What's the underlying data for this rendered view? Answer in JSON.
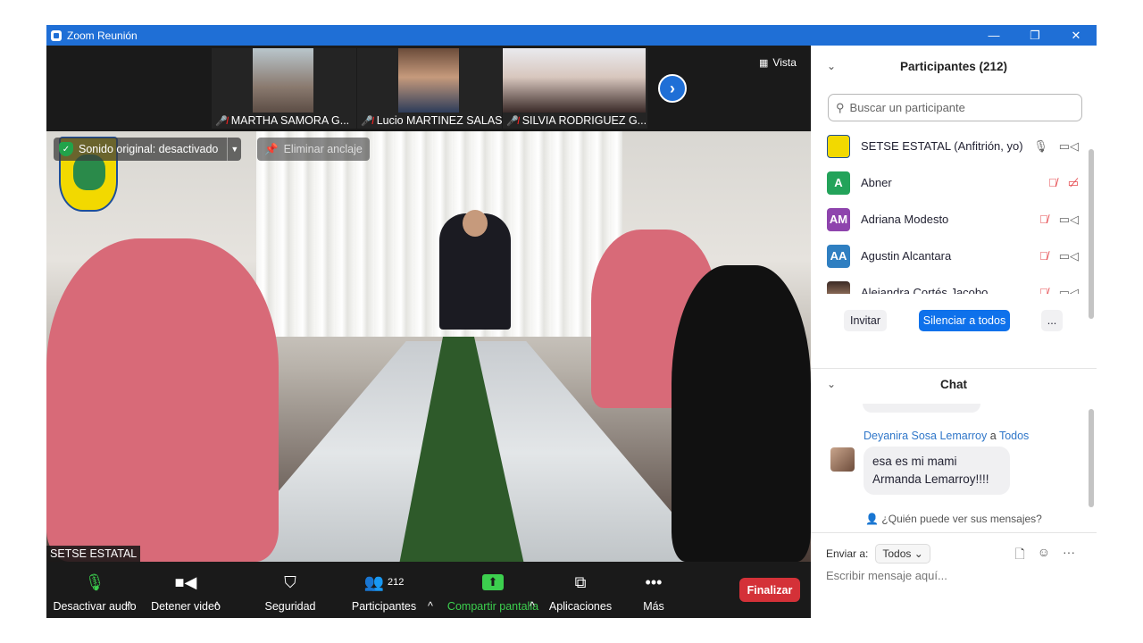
{
  "window": {
    "title": "Zoom Reunión",
    "minimize": "—",
    "restore": "❐",
    "close": "✕"
  },
  "strip": {
    "thumbs": [
      {
        "name": "MARTHA SAMORA G..."
      },
      {
        "name": "Lucio MARTINEZ SALAS"
      },
      {
        "name": "SILVIA RODRIGUEZ G..."
      }
    ],
    "next_icon": "chevron-right-icon",
    "view_label": "Vista"
  },
  "main_video": {
    "original_sound": "Sonido original: desactivado",
    "unpin": "Eliminar anclaje",
    "name": "SETSE ESTATAL"
  },
  "toolbar": {
    "mute": "Desactivar audio",
    "video": "Detener video",
    "security": "Seguridad",
    "participants": "Participantes",
    "participants_count": "212",
    "share": "Compartir pantalla",
    "apps": "Aplicaciones",
    "more": "Más",
    "end": "Finalizar"
  },
  "participants_panel": {
    "title": "Participantes (212)",
    "search_placeholder": "Buscar un participante",
    "list": [
      {
        "name": "SETSE ESTATAL (Anfitrión, yo)",
        "initials": "",
        "color": "#f2d900",
        "mic_muted": false,
        "video_off": false
      },
      {
        "name": "Abner",
        "initials": "A",
        "color": "#23a35a",
        "mic_muted": true,
        "video_off": true
      },
      {
        "name": "Adriana Modesto",
        "initials": "AM",
        "color": "#8e44ad",
        "mic_muted": true,
        "video_off": false
      },
      {
        "name": "Agustin Alcantara",
        "initials": "AA",
        "color": "#2f7fc1",
        "mic_muted": true,
        "video_off": false
      },
      {
        "name": "Alejandra Cortés Jacobo",
        "initials": "",
        "color": "#b98c74",
        "mic_muted": true,
        "video_off": false
      }
    ],
    "invite": "Invitar",
    "mute_all": "Silenciar a todos",
    "more": "..."
  },
  "chat": {
    "title": "Chat",
    "message": {
      "from": "Deyanira Sosa Lemarroy",
      "to_sep": "a",
      "to": "Todos",
      "text_line1": "esa es mi mami",
      "text_line2": "Armanda Lemarroy!!!!"
    },
    "who_can_see": "¿Quién puede ver sus mensajes?",
    "send_to_label": "Enviar a:",
    "send_to_value": "Todos",
    "input_placeholder": "Escribir mensaje aquí..."
  }
}
